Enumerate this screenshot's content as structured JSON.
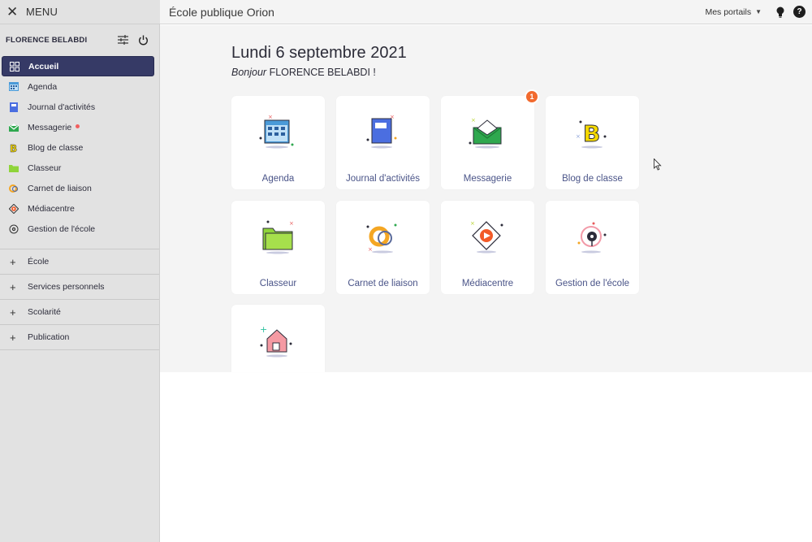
{
  "header": {
    "menu_label": "MENU",
    "app_title": "École publique Orion",
    "portals_label": "Mes portails",
    "help_label": "?"
  },
  "user": {
    "name": "FLORENCE BELABDI"
  },
  "sidebar": {
    "items": [
      {
        "label": "Accueil",
        "icon": "grid-icon",
        "active": true
      },
      {
        "label": "Agenda",
        "icon": "calendar-icon"
      },
      {
        "label": "Journal d'activités",
        "icon": "journal-icon"
      },
      {
        "label": "Messagerie",
        "icon": "envelope-icon",
        "dot": true
      },
      {
        "label": "Blog de classe",
        "icon": "blog-icon"
      },
      {
        "label": "Classeur",
        "icon": "folder-icon"
      },
      {
        "label": "Carnet de liaison",
        "icon": "carnet-icon"
      },
      {
        "label": "Médiacentre",
        "icon": "play-icon"
      },
      {
        "label": "Gestion de l'école",
        "icon": "compass-icon"
      }
    ],
    "sections": [
      {
        "label": "École"
      },
      {
        "label": "Services personnels"
      },
      {
        "label": "Scolarité"
      },
      {
        "label": "Publication"
      }
    ]
  },
  "main": {
    "date": "Lundi 6 septembre 2021",
    "greeting_prefix": "Bonjour",
    "greeting_name": "FLORENCE BELABDI !",
    "tiles": [
      {
        "label": "Agenda",
        "icon": "calendar-icon"
      },
      {
        "label": "Journal d'activités",
        "icon": "journal-icon"
      },
      {
        "label": "Messagerie",
        "icon": "envelope-icon",
        "badge": "1"
      },
      {
        "label": "Blog de classe",
        "icon": "blog-icon"
      },
      {
        "label": "Classeur",
        "icon": "folder-icon"
      },
      {
        "label": "Carnet de liaison",
        "icon": "carnet-icon"
      },
      {
        "label": "Médiacentre",
        "icon": "play-icon"
      },
      {
        "label": "Gestion de l'école",
        "icon": "compass-icon"
      },
      {
        "label": "",
        "icon": "house-icon"
      }
    ]
  },
  "colors": {
    "sidebar_active": "#363a66",
    "tile_label": "#4a5488",
    "badge": "#f26a2e",
    "notification_dot": "#f15f5f"
  }
}
